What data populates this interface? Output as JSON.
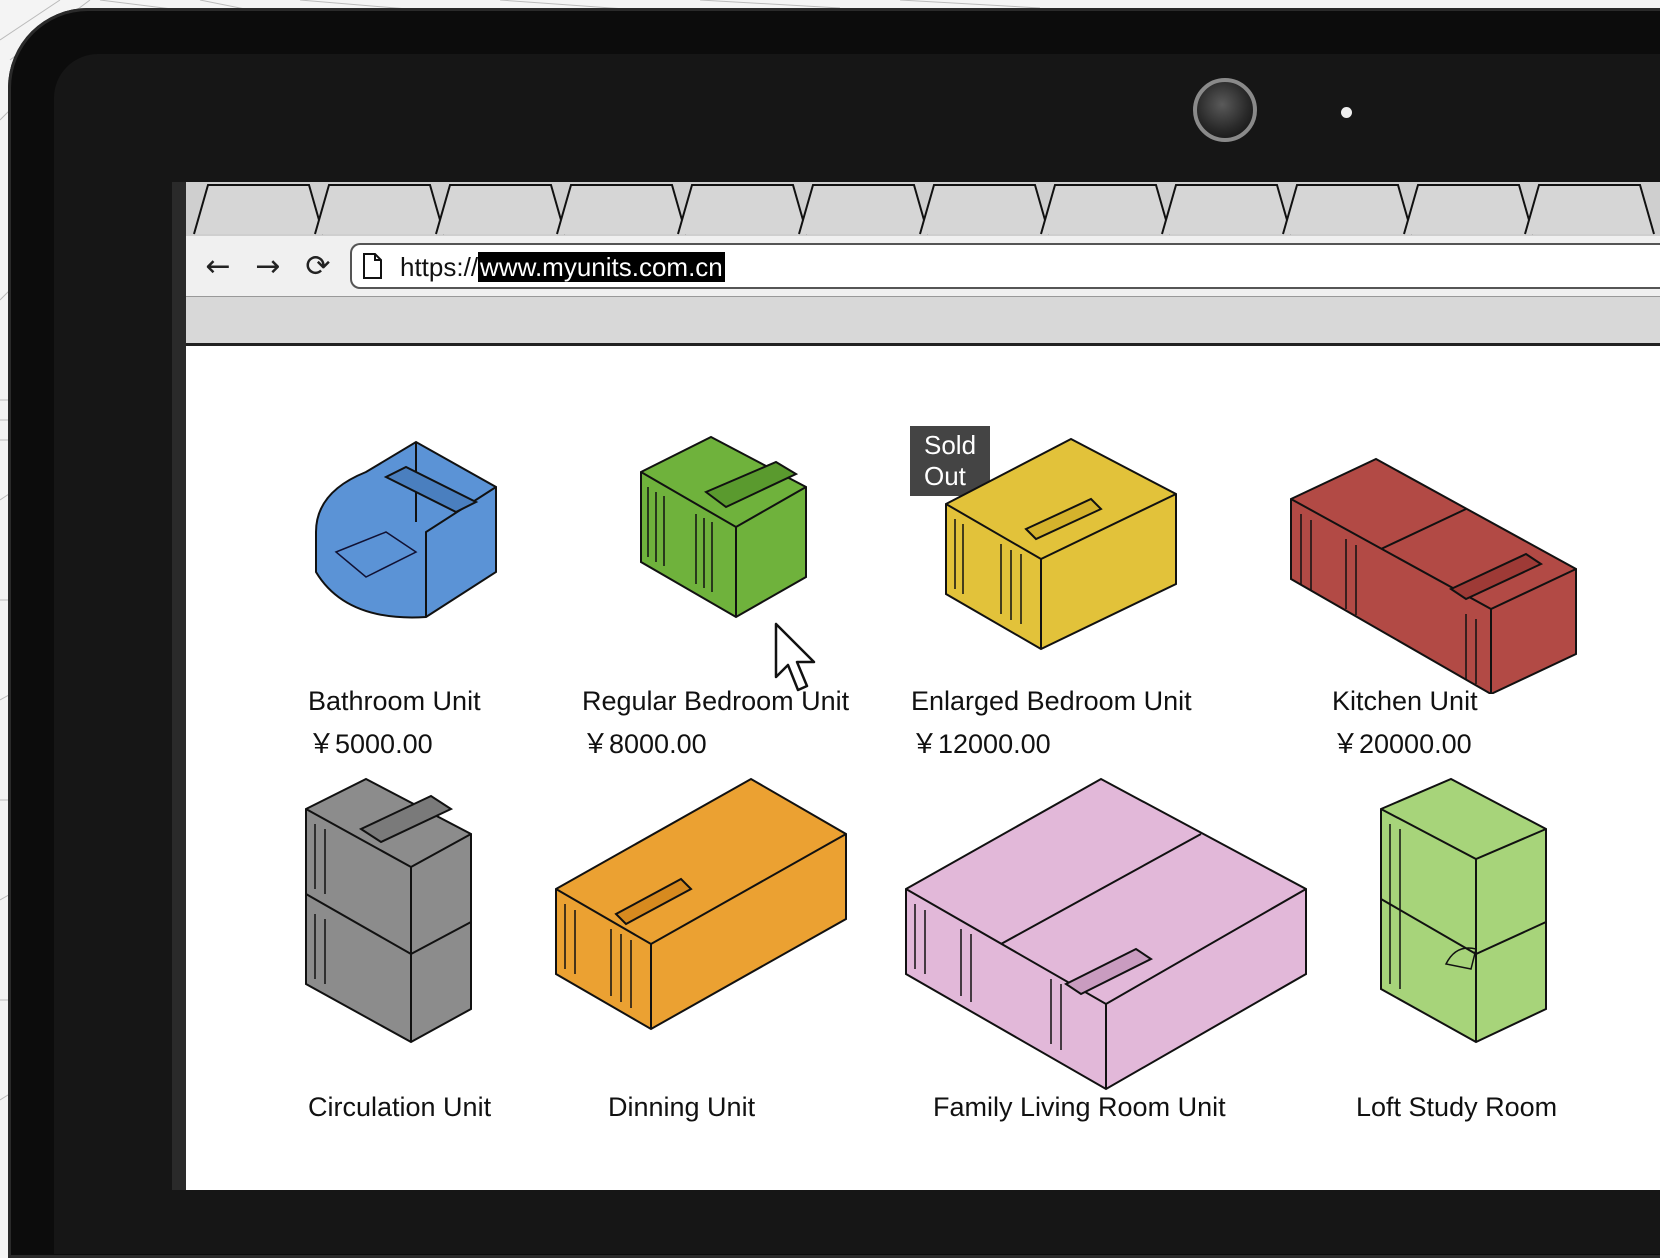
{
  "browser": {
    "url_prefix": "https://",
    "url_host": "www.myunits.com.cn",
    "tab_count": 12
  },
  "products": [
    {
      "name": "Bathroom Unit",
      "price": "￥5000.00",
      "color": "#5b93d6"
    },
    {
      "name": "Regular Bedroom Unit",
      "price": "￥8000.00",
      "color": "#6fb23c"
    },
    {
      "name": "Enlarged Bedroom Unit",
      "price": "￥12000.00",
      "color": "#e2c23a",
      "badge": "Sold Out"
    },
    {
      "name": "Kitchen Unit",
      "price": "￥20000.00",
      "color": "#b24a45"
    },
    {
      "name": "Circulation Unit",
      "price": "",
      "color": "#8c8c8c"
    },
    {
      "name": "Dinning Unit",
      "price": "",
      "color": "#eba132"
    },
    {
      "name": "Family Living Room Unit",
      "price": "",
      "color": "#e2b8d9"
    },
    {
      "name": "Loft Study Room",
      "price": "",
      "color": "#a7d47a"
    }
  ],
  "icons": {
    "back": "arrow-left-icon",
    "forward": "arrow-right-icon",
    "reload": "reload-icon",
    "page": "page-icon",
    "cursor": "mouse-pointer-icon"
  }
}
